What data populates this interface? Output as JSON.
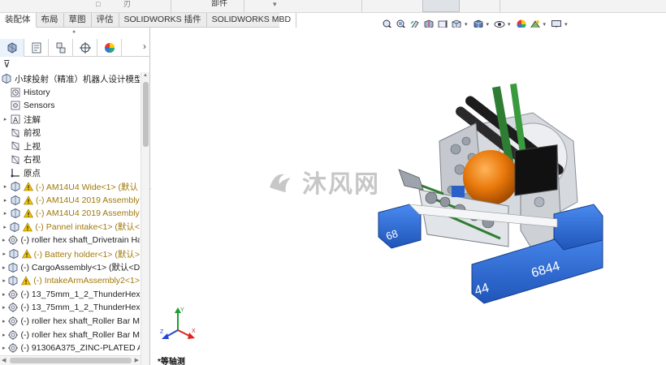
{
  "ribbon": {
    "glyph_left": "□",
    "glyph_mid": "刃",
    "label": "部件",
    "caret": "▾"
  },
  "tabs": [
    {
      "label": "装配体",
      "active": true
    },
    {
      "label": "布局",
      "active": false
    },
    {
      "label": "草图",
      "active": false
    },
    {
      "label": "评估",
      "active": false
    },
    {
      "label": "SOLIDWORKS 插件",
      "active": false
    },
    {
      "label": "SOLIDWORKS MBD",
      "active": false
    }
  ],
  "view_toolbar": {
    "icons": [
      "zoom-to-fit-icon",
      "zoom-to-area-icon",
      "previous-view-icon",
      "section-view-icon",
      "dynamic-annotation-icon",
      "view-orientation-icon",
      "display-style-icon",
      "hide-show-items-icon",
      "edit-appearance-icon",
      "apply-scene-icon",
      "view-settings-icon"
    ]
  },
  "feature_manager": {
    "splitter_glyph": "●",
    "more_glyph": "›",
    "filter_glyph": "⊽",
    "root": "小球投射（精准）机器人设计模型（De",
    "items": [
      {
        "label": "History",
        "icon": "history-icon",
        "expander": "",
        "warning": false,
        "color": "normal"
      },
      {
        "label": "Sensors",
        "icon": "sensors-icon",
        "expander": "",
        "warning": false,
        "color": "normal"
      },
      {
        "label": "注解",
        "icon": "annotations-icon",
        "expander": "▸",
        "warning": false,
        "color": "normal"
      },
      {
        "label": "前视",
        "icon": "plane-icon",
        "expander": "",
        "warning": false,
        "color": "normal"
      },
      {
        "label": "上视",
        "icon": "plane-icon",
        "expander": "",
        "warning": false,
        "color": "normal"
      },
      {
        "label": "右视",
        "icon": "plane-icon",
        "expander": "",
        "warning": false,
        "color": "normal"
      },
      {
        "label": "原点",
        "icon": "origin-icon",
        "expander": "",
        "warning": false,
        "color": "normal"
      },
      {
        "label": "(-) AM14U4 Wide<1> (默认",
        "icon": "subassembly-icon",
        "expander": "▸",
        "warning": true,
        "color": "yellow"
      },
      {
        "label": "(-) AM14U4 2019 Assembly",
        "icon": "subassembly-icon",
        "expander": "▸",
        "warning": true,
        "color": "yellow"
      },
      {
        "label": "(-) AM14U4 2019 Assembly",
        "icon": "subassembly-icon",
        "expander": "▸",
        "warning": true,
        "color": "yellow"
      },
      {
        "label": "(-) Pannel intake<1> (默认<",
        "icon": "subassembly-icon",
        "expander": "▸",
        "warning": true,
        "color": "yellow"
      },
      {
        "label": "(-) roller hex shaft_Drivetrain Ha",
        "icon": "part-icon",
        "expander": "▸",
        "warning": false,
        "color": "normal"
      },
      {
        "label": "(-) Battery holder<1> (默认>",
        "icon": "subassembly-icon",
        "expander": "▸",
        "warning": true,
        "color": "yellow"
      },
      {
        "label": "(-) CargoAssembly<1> (默认<D",
        "icon": "subassembly-icon",
        "expander": "▸",
        "warning": false,
        "color": "normal"
      },
      {
        "label": "(-) IntakeArmAssembly2<1>",
        "icon": "subassembly-icon",
        "expander": "▸",
        "warning": true,
        "color": "yellow"
      },
      {
        "label": "(-) 13_75mm_1_2_ThunderHex_II",
        "icon": "part-icon",
        "expander": "▸",
        "warning": false,
        "color": "normal"
      },
      {
        "label": "(-) 13_75mm_1_2_ThunderHex_II",
        "icon": "part-icon",
        "expander": "▸",
        "warning": false,
        "color": "normal"
      },
      {
        "label": "(-) roller hex shaft_Roller Bar M",
        "icon": "part-icon",
        "expander": "▸",
        "warning": false,
        "color": "normal"
      },
      {
        "label": "(-) roller hex shaft_Roller Bar M",
        "icon": "part-icon",
        "expander": "▸",
        "warning": false,
        "color": "normal"
      },
      {
        "label": "(-) 91306A375_ZINC-PLATED AL",
        "icon": "part-icon",
        "expander": "▸",
        "warning": false,
        "color": "normal"
      }
    ]
  },
  "viewport": {
    "watermark_text": "沐风网",
    "view_name": "*等轴测",
    "bumper_numbers": [
      "68",
      "6844",
      "44"
    ],
    "colors": {
      "bumper": "#2f6fd6",
      "ball": "#e8780a",
      "frame": "#c8ccd2",
      "arm": "#2e7d32",
      "roller": "#1c1c1c",
      "warning": "#f2c200"
    }
  }
}
